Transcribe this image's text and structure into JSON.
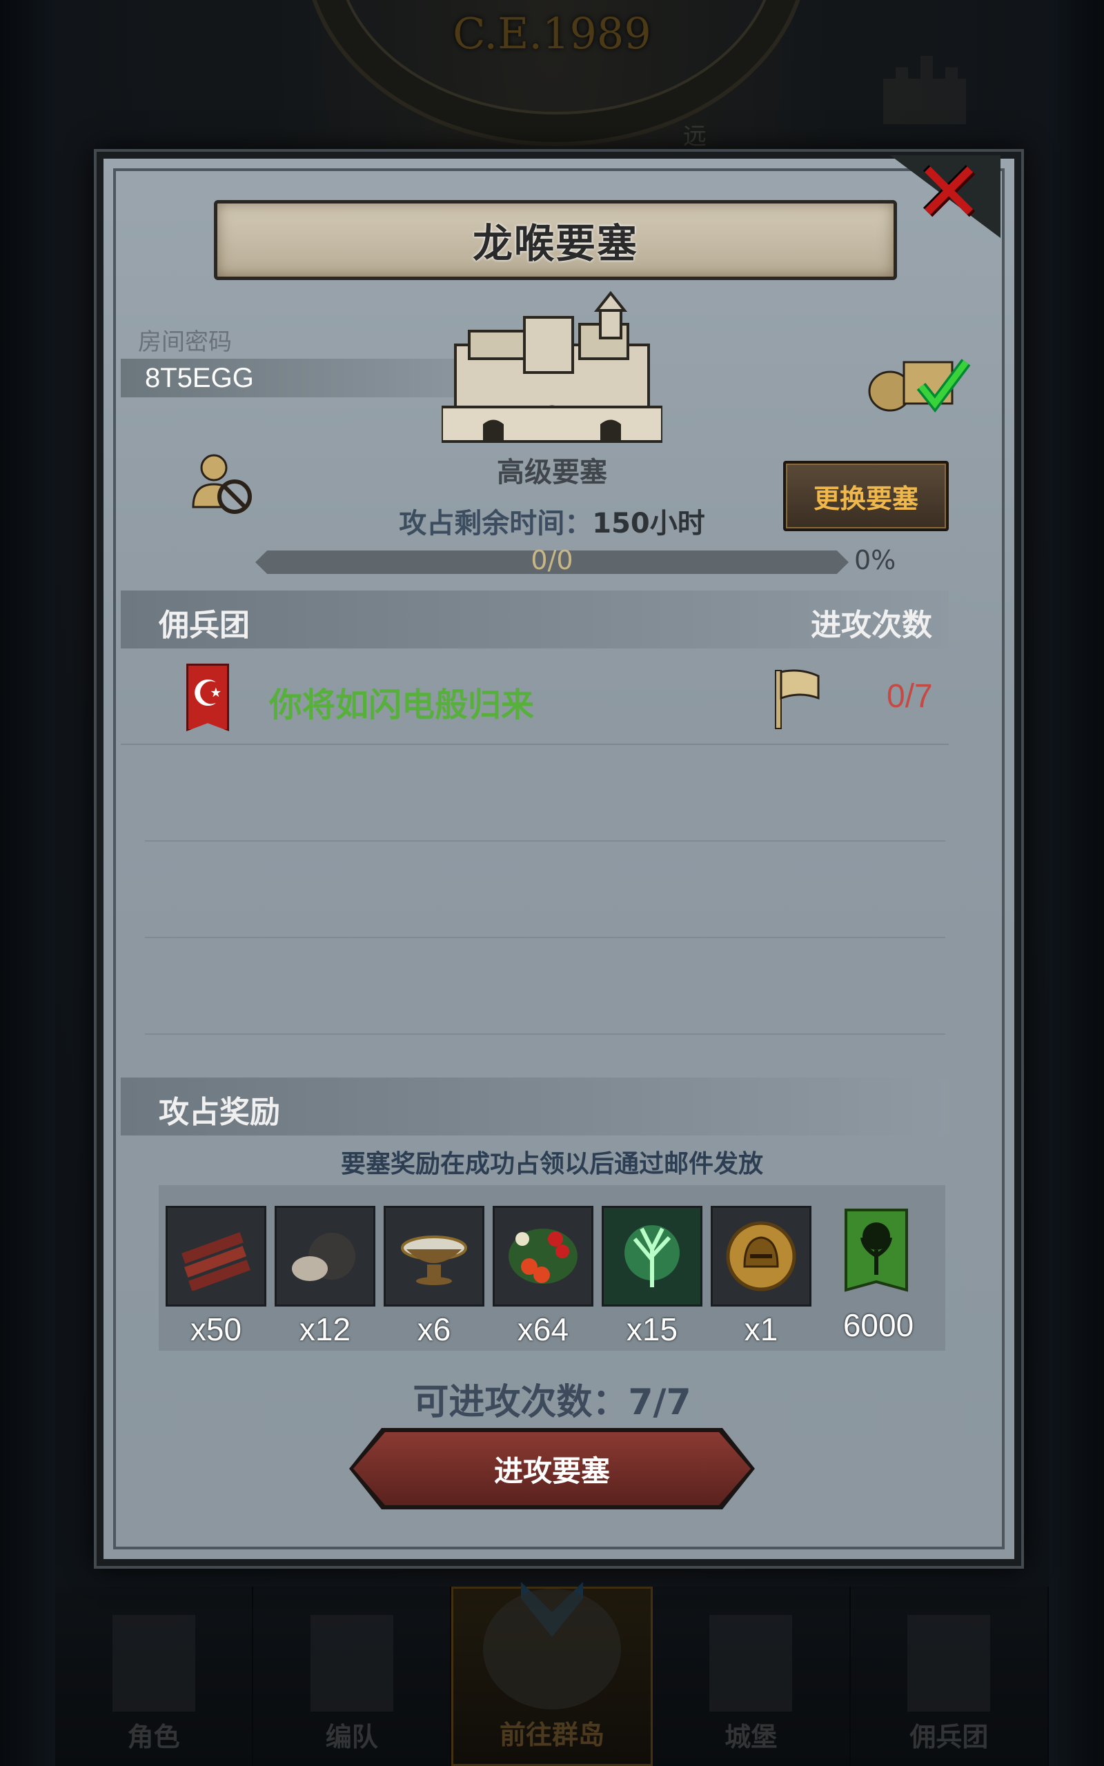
{
  "background": {
    "year": "C.E.1989",
    "remote_label": "远"
  },
  "dialog": {
    "title": "龙喉要塞",
    "room_password_label": "房间密码",
    "room_password": "8T5EGG",
    "fortress_type": "高级要塞",
    "change_button": "更换要塞",
    "time_label": "攻占剩余时间：",
    "time_value": "150小时",
    "progress_text": "0/0",
    "progress_percent": "0%",
    "progress_fraction": 0,
    "mercenary_header": "佣兵团",
    "attack_count_header": "进攻次数",
    "mercenary": {
      "emblem": "☪",
      "name": "你将如闪电般归来",
      "count": "0/7"
    },
    "reward_header": "攻占奖励",
    "reward_note": "要塞奖励在成功占领以后通过邮件发放",
    "rewards": [
      {
        "icon": "wood-icon",
        "qty": "x50"
      },
      {
        "icon": "truffle-icon",
        "qty": "x12"
      },
      {
        "icon": "bowl-icon",
        "qty": "x6"
      },
      {
        "icon": "berries-icon",
        "qty": "x64"
      },
      {
        "icon": "spirit-tree-icon",
        "qty": "x15"
      },
      {
        "icon": "helmet-coin-icon",
        "qty": "x1"
      },
      {
        "icon": "guild-banner-icon",
        "qty": "6000"
      }
    ],
    "attacks_left": "可进攻次数：7/7",
    "attack_button": "进攻要塞"
  },
  "bottom_nav": [
    {
      "label": "角色"
    },
    {
      "label": "编队"
    },
    {
      "label": "前往群岛",
      "active": true
    },
    {
      "label": "城堡"
    },
    {
      "label": "佣兵团"
    }
  ],
  "colors": {
    "accent_gold": "#f0b84a",
    "merc_green": "#58b03c",
    "count_red": "#c44a43",
    "close_red": "#c21717"
  }
}
